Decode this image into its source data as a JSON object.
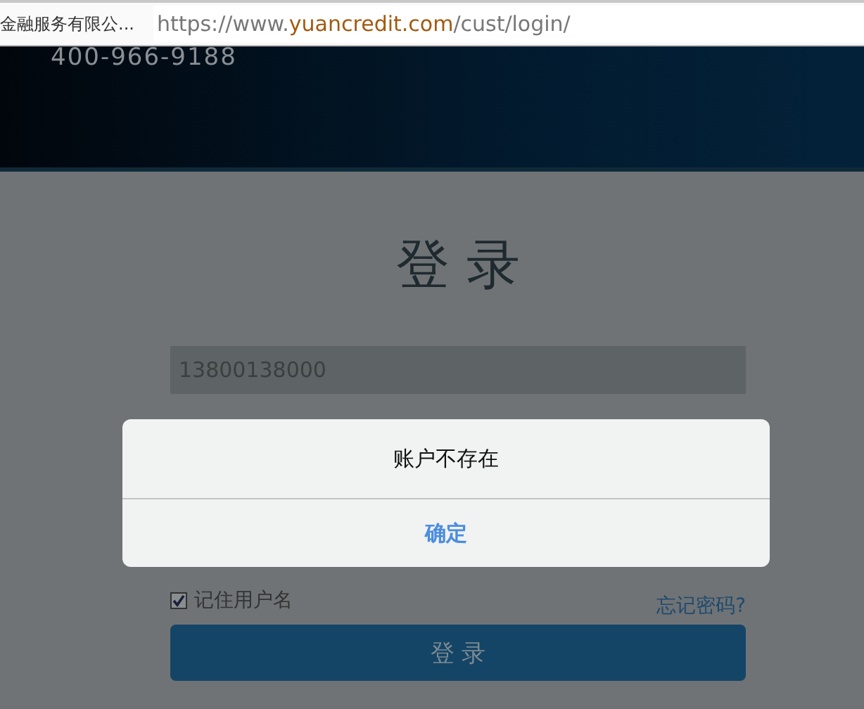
{
  "browser": {
    "tab_title": "金融服务有限公...",
    "url_host": "https://www.",
    "url_domain": "yuancredit.com",
    "url_path": "/cust/login/"
  },
  "header": {
    "hotline": "400-966-9188"
  },
  "login": {
    "title": "登 录",
    "phone_value": "13800138000",
    "remember": {
      "label": "记住用户名",
      "checked": true
    },
    "forgot_link": "忘记密码?",
    "submit": "登 录"
  },
  "dialog": {
    "message": "账户不存在",
    "ok": "确定"
  }
}
